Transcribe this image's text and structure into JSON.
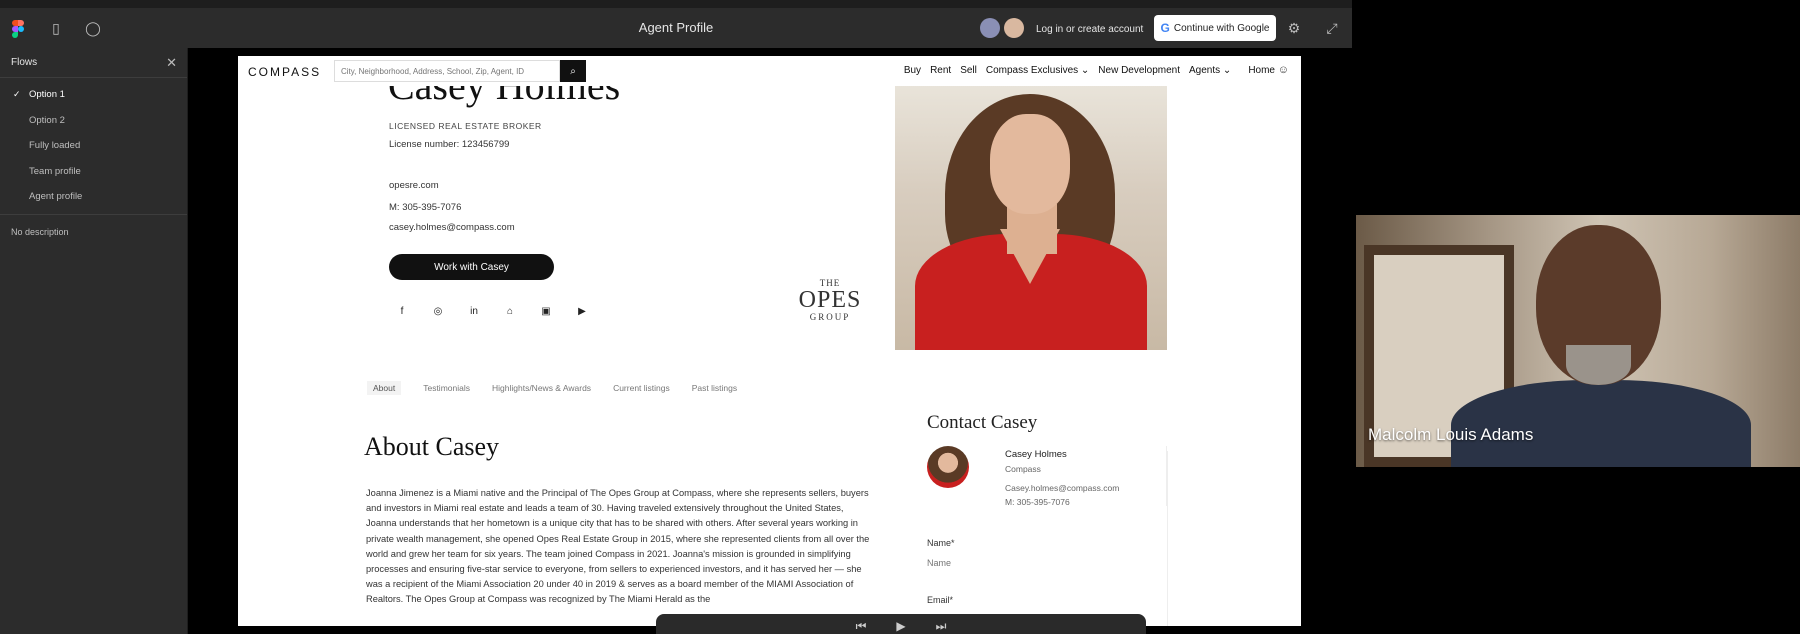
{
  "figma": {
    "title": "Agent Profile",
    "login_link": "Log in or create account",
    "google_button": "Continue with Google",
    "google_g": "G",
    "flows_heading": "Flows",
    "flows": [
      {
        "label": "Option 1",
        "active": true
      },
      {
        "label": "Option 2"
      },
      {
        "label": "Fully loaded"
      },
      {
        "label": "Team profile"
      },
      {
        "label": "Agent profile"
      }
    ],
    "description": "No description"
  },
  "compass": {
    "logo": "COMPASS",
    "search_placeholder": "City, Neighborhood, Address, School, Zip, Agent, ID",
    "menu": [
      "Buy",
      "Rent",
      "Sell",
      "Compass Exclusives ⌄",
      "New Development",
      "Agents ⌄",
      "Home"
    ],
    "agent": {
      "name": "Casey Holmes",
      "title": "LICENSED REAL ESTATE BROKER",
      "license": "License number: 123456799",
      "website": "opesre.com",
      "phone": "M: 305-395-7076",
      "email": "casey.holmes@compass.com",
      "cta": "Work with Casey"
    },
    "social_icons": [
      "facebook-icon",
      "instagram-icon",
      "linkedin-icon",
      "zillow-icon",
      "realtor-icon",
      "youtube-icon"
    ],
    "brand_logo": {
      "the": "THE",
      "opes": "OPES",
      "group": "GROUP"
    },
    "tabs": [
      "About",
      "Testimonials",
      "Highlights/News & Awards",
      "Current listings",
      "Past listings"
    ],
    "about_title": "About Casey",
    "about_body": "Joanna Jimenez is a Miami native and the Principal of The Opes Group at Compass, where she represents sellers, buyers and investors in Miami real estate and leads a team of 30. Having traveled extensively throughout the United States, Joanna understands that her hometown is a unique city that has to be shared with others. After several years working in private wealth management, she opened Opes Real Estate Group in 2015, where she represented clients from all over the world and grew her team for six years. The team joined Compass in 2021. Joanna's mission is grounded in simplifying processes and ensuring five-star service to everyone, from sellers to experienced investors, and it has served her — she was a recipient of the Miami Association 20 under 40 in 2019 & serves as a board member of the MIAMI Association of Realtors. The Opes Group at Compass was recognized by The Miami Herald as the",
    "contact": {
      "title": "Contact Casey",
      "name": "Casey Holmes",
      "company": "Compass",
      "email": "Casey.holmes@compass.com",
      "phone": "M: 305-395-7076",
      "name_label": "Name*",
      "name_placeholder": "Name",
      "email_label": "Email*"
    }
  },
  "video": {
    "participant_name": "Malcolm Louis Adams"
  },
  "colors": {
    "figma_chrome": "#2c2c2c",
    "compass_black": "#111111",
    "dress_red": "#c8201f"
  }
}
